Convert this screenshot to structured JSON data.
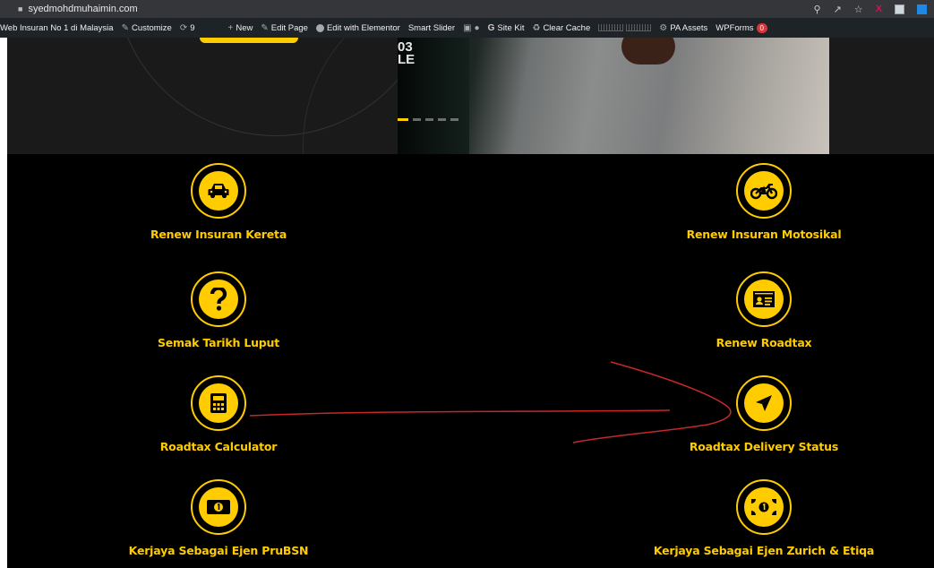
{
  "browser": {
    "url": "syedmohdmuhaimin.com"
  },
  "adminbar": {
    "site_name": "Web Insuran No 1 di Malaysia",
    "customize": "Customize",
    "updates_count": "9",
    "new": "New",
    "edit_page": "Edit Page",
    "edit_elementor": "Edit with Elementor",
    "smart_slider": "Smart Slider",
    "site_kit": "Site Kit",
    "clear_cache": "Clear Cache",
    "pa_assets": "PA Assets",
    "wpforms": "WPForms",
    "wpforms_count": "0"
  },
  "hero": {
    "photo_digits_line1": "03",
    "photo_digits_line2": "LE"
  },
  "services": {
    "renew_car": {
      "label": "Renew Insuran Kereta",
      "icon": "car-icon"
    },
    "renew_moto": {
      "label": "Renew Insuran Motosikal",
      "icon": "motorcycle-icon"
    },
    "check_expiry": {
      "label": "Semak Tarikh Luput",
      "icon": "question-icon"
    },
    "renew_roadtax": {
      "label": "Renew Roadtax",
      "icon": "id-card-icon"
    },
    "calculator": {
      "label": "Roadtax Calculator",
      "icon": "calculator-icon"
    },
    "delivery": {
      "label": "Roadtax Delivery Status",
      "icon": "paper-plane-icon"
    },
    "agent_prubsn": {
      "label": "Kerjaya Sebagai Ejen PruBSN",
      "icon": "money-icon"
    },
    "agent_zurich": {
      "label": "Kerjaya Sebagai Ejen Zurich & Etiqa",
      "icon": "money-icon"
    }
  },
  "colors": {
    "accent": "#ffcc00",
    "background": "#000000",
    "annotation": "#c62828"
  }
}
